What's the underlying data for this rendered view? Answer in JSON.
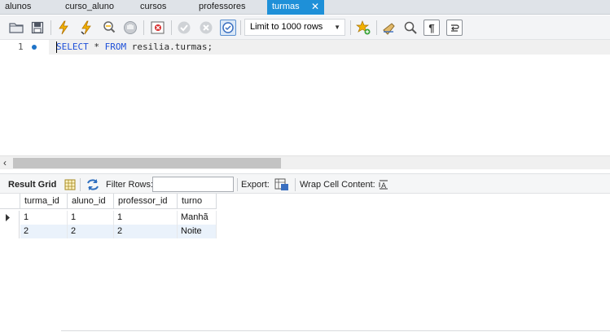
{
  "tabs": [
    "alunos",
    "curso_aluno",
    "cursos",
    "professores",
    "turmas"
  ],
  "active_tab_close": "✕",
  "toolbar": {
    "limit_label": "Limit to 1000 rows",
    "icons": [
      "open-folder-icon",
      "save-icon",
      "execute-icon",
      "execute-current-icon",
      "explain-icon",
      "stop-icon",
      "toggle-error-icon",
      "commit-icon",
      "rollback-icon",
      "autocommit-icon",
      "beautify-icon",
      "brush-icon",
      "find-icon",
      "invisible-chars-icon",
      "wrap-icon"
    ]
  },
  "editor": {
    "line_number": "1",
    "keywords": {
      "select": "SELECT",
      "from": "FROM"
    },
    "star": " * ",
    "table": "resilia.turmas",
    "terminator": ";"
  },
  "result_bar": {
    "result_grid": "Result Grid",
    "filter_rows": "Filter Rows:",
    "filter_value": "",
    "export": "Export:",
    "wrap": "Wrap Cell Content:"
  },
  "grid": {
    "columns": [
      "turma_id",
      "aluno_id",
      "professor_id",
      "turno"
    ],
    "rows": [
      [
        "1",
        "1",
        "1",
        "Manhã"
      ],
      [
        "2",
        "2",
        "2",
        "Noite"
      ]
    ]
  },
  "colors": {
    "accent": "#1e90d8",
    "keyword": "#1d4fd8"
  }
}
